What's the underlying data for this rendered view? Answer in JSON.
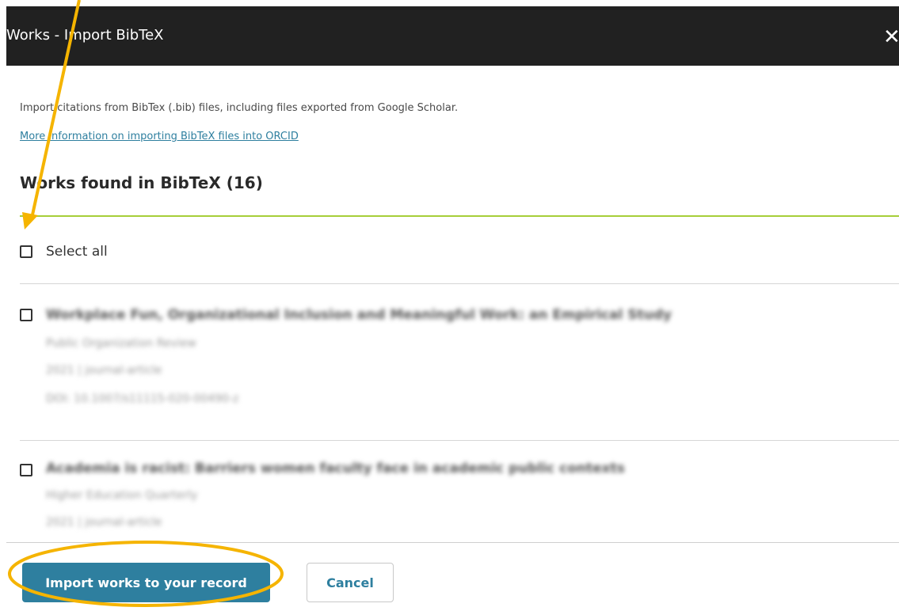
{
  "dialog": {
    "title": "Works - Import BibTeX",
    "close_glyph": "✕"
  },
  "intro_text": "Import citations from BibTex (.bib) files, including files exported from Google Scholar.",
  "info_link": "More information on importing BibTeX files into ORCID",
  "section_title": "Works found in BibTeX (16)",
  "select_all_label": "Select all",
  "works": [
    {
      "title": "Workplace Fun, Organizational Inclusion and Meaningful Work: an Empirical Study",
      "journal": "Public Organization Review",
      "meta": "2021 | journal-article",
      "doi": "DOI: 10.1007/s11115-020-00490-z"
    },
    {
      "title": "Academia is racist: Barriers women faculty face in academic public contexts",
      "journal": "Higher Education Quarterly",
      "meta": "2021 | journal-article"
    }
  ],
  "footer": {
    "import_label": "Import works to your record",
    "cancel_label": "Cancel"
  },
  "colors": {
    "header_bg": "#212121",
    "accent_teal": "#2e7f9f",
    "green_rule": "#a6ce39",
    "annotation_yellow": "#f5b400"
  }
}
